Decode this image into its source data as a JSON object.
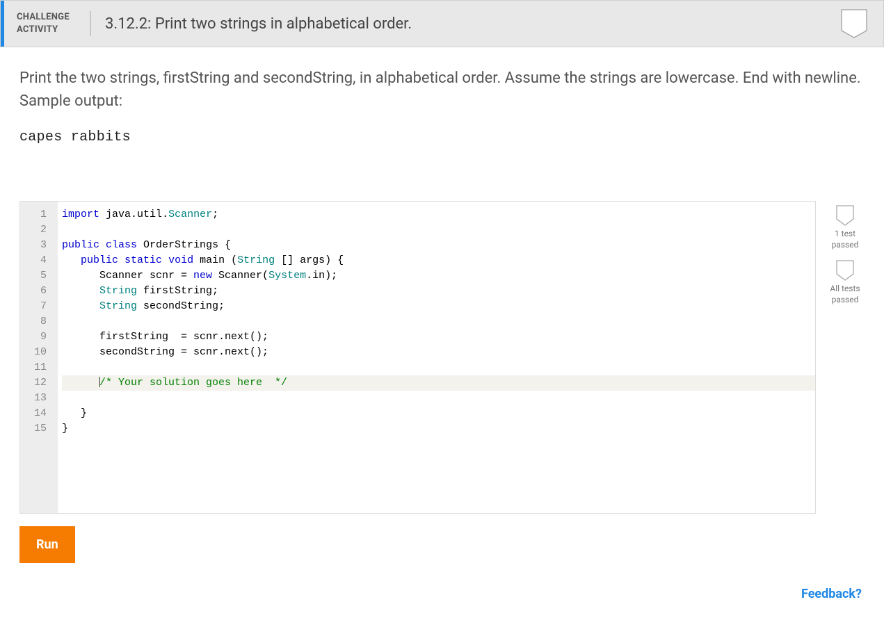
{
  "header": {
    "label_line1": "CHALLENGE",
    "label_line2": "ACTIVITY",
    "title": "3.12.2: Print two strings in alphabetical order."
  },
  "description": "Print the two strings, firstString and secondString, in alphabetical order. Assume the strings are lowercase. End with newline. Sample output:",
  "sample_output": "capes rabbits",
  "code": {
    "lines": [
      {
        "num": "1",
        "segments": [
          {
            "t": "import",
            "c": "k-blue"
          },
          {
            "t": " java",
            "c": "k-black"
          },
          {
            "t": ".",
            "c": "k-black"
          },
          {
            "t": "util",
            "c": "k-black"
          },
          {
            "t": ".",
            "c": "k-black"
          },
          {
            "t": "Scanner",
            "c": "k-teal"
          },
          {
            "t": ";",
            "c": "k-black"
          }
        ]
      },
      {
        "num": "2",
        "segments": []
      },
      {
        "num": "3",
        "segments": [
          {
            "t": "public",
            "c": "k-blue"
          },
          {
            "t": " ",
            "c": "k-black"
          },
          {
            "t": "class",
            "c": "k-blue"
          },
          {
            "t": " OrderStrings {",
            "c": "k-black"
          }
        ]
      },
      {
        "num": "4",
        "segments": [
          {
            "t": "   ",
            "c": "k-black"
          },
          {
            "t": "public",
            "c": "k-blue"
          },
          {
            "t": " ",
            "c": "k-black"
          },
          {
            "t": "static",
            "c": "k-blue"
          },
          {
            "t": " ",
            "c": "k-black"
          },
          {
            "t": "void",
            "c": "k-blue"
          },
          {
            "t": " main (",
            "c": "k-black"
          },
          {
            "t": "String",
            "c": "k-teal"
          },
          {
            "t": " [] args) {",
            "c": "k-black"
          }
        ]
      },
      {
        "num": "5",
        "segments": [
          {
            "t": "      Scanner scnr = ",
            "c": "k-black"
          },
          {
            "t": "new",
            "c": "k-blue"
          },
          {
            "t": " Scanner(",
            "c": "k-black"
          },
          {
            "t": "System",
            "c": "k-teal"
          },
          {
            "t": ".in);",
            "c": "k-black"
          }
        ]
      },
      {
        "num": "6",
        "segments": [
          {
            "t": "      ",
            "c": "k-black"
          },
          {
            "t": "String",
            "c": "k-teal"
          },
          {
            "t": " firstString;",
            "c": "k-black"
          }
        ]
      },
      {
        "num": "7",
        "segments": [
          {
            "t": "      ",
            "c": "k-black"
          },
          {
            "t": "String",
            "c": "k-teal"
          },
          {
            "t": " secondString;",
            "c": "k-black"
          }
        ]
      },
      {
        "num": "8",
        "segments": []
      },
      {
        "num": "9",
        "segments": [
          {
            "t": "      firstString  = scnr.next();",
            "c": "k-black"
          }
        ]
      },
      {
        "num": "10",
        "segments": [
          {
            "t": "      secondString = scnr.next();",
            "c": "k-black"
          }
        ]
      },
      {
        "num": "11",
        "segments": []
      },
      {
        "num": "12",
        "highlight": true,
        "cursor": true,
        "segments": [
          {
            "t": "      ",
            "c": "k-black"
          },
          {
            "t": "/* Your solution goes here  */",
            "c": "k-green"
          }
        ]
      },
      {
        "num": "13",
        "segments": []
      },
      {
        "num": "14",
        "segments": [
          {
            "t": "   }",
            "c": "k-black"
          }
        ]
      },
      {
        "num": "15",
        "segments": [
          {
            "t": "}",
            "c": "k-black"
          }
        ]
      }
    ]
  },
  "status": {
    "item1": "1 test passed",
    "item2": "All tests passed"
  },
  "run_label": "Run",
  "feedback_label": "Feedback?"
}
